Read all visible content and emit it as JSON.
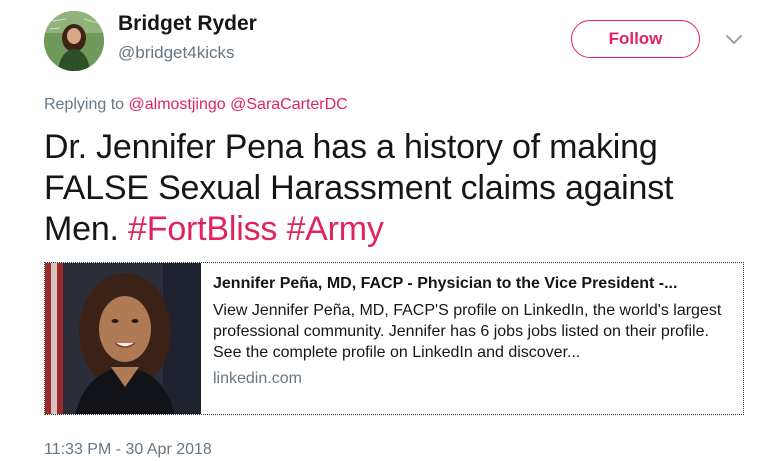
{
  "user": {
    "display_name": "Bridget Ryder",
    "handle": "@bridget4kicks",
    "avatar_icon": "profile-avatar"
  },
  "actions": {
    "follow_label": "Follow",
    "more_icon": "chevron-down-icon"
  },
  "reply": {
    "prefix": "Replying to",
    "mentions": [
      "@almostjingo",
      "@SaraCarterDC"
    ]
  },
  "tweet": {
    "text_plain": "Dr. Jennifer Pena has a history of making FALSE Sexual Harassment claims against Men.",
    "hashtags": [
      "#FortBliss",
      "#Army"
    ]
  },
  "card": {
    "title": "Jennifer Peña, MD, FACP - Physician to the Vice President -...",
    "description": "View Jennifer Peña, MD, FACP'S profile on LinkedIn, the world's largest professional community. Jennifer has 6 jobs jobs listed on their profile. See the complete profile on LinkedIn and discover...",
    "domain": "linkedin.com"
  },
  "timestamp": "11:33 PM - 30 Apr 2018",
  "colors": {
    "accent": "#e0245e",
    "secondary_text": "#657786",
    "primary_text": "#14171a"
  }
}
